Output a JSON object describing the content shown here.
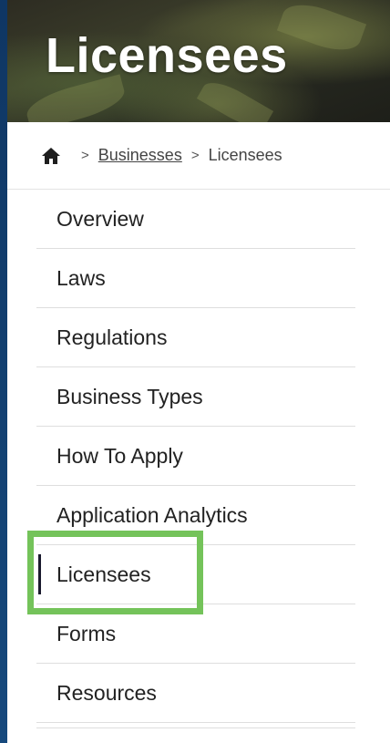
{
  "hero": {
    "title": "Licensees"
  },
  "breadcrumb": {
    "home_icon": "home-icon",
    "separator": ">",
    "items": [
      "Businesses",
      "Licensees"
    ]
  },
  "nav": {
    "items": [
      {
        "label": "Overview"
      },
      {
        "label": "Laws"
      },
      {
        "label": "Regulations"
      },
      {
        "label": "Business Types"
      },
      {
        "label": "How To Apply"
      },
      {
        "label": "Application Analytics"
      },
      {
        "label": "Licensees",
        "active": true
      },
      {
        "label": "Forms"
      },
      {
        "label": "Resources"
      }
    ]
  },
  "colors": {
    "background": "#123d6b",
    "highlight": "#74c35a",
    "text": "#222222"
  }
}
